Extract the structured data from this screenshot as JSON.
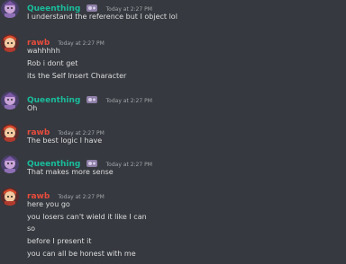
{
  "users": {
    "queenthing": {
      "name": "Queenthing",
      "color": "#1abc9c"
    },
    "rawb": {
      "name": "rawb",
      "color": "#e74c3c"
    }
  },
  "messages": [
    {
      "user": "Queenthing",
      "time": "Today at 2:27 PM",
      "lines": [
        "I understand the reference but I object lol"
      ]
    },
    {
      "user": "rawb",
      "time": "Today at 2:27 PM",
      "lines": [
        "wahhhhh",
        "Rob i dont get",
        "its the Self Insert Character"
      ]
    },
    {
      "user": "Queenthing",
      "time": "Today at 2:27 PM",
      "lines": [
        "Oh"
      ]
    },
    {
      "user": "rawb",
      "time": "Today at 2:27 PM",
      "lines": [
        "The best logic I have"
      ]
    },
    {
      "user": "Queenthing",
      "time": "Today at 2:27 PM",
      "lines": [
        "That makes more sense"
      ]
    },
    {
      "user": "rawb",
      "time": "Today at 2:27 PM",
      "lines": [
        "here you go",
        "you losers can't wield it like I can",
        "so",
        "before I present it",
        "you can all be honest with me"
      ]
    }
  ],
  "icons": {
    "queenthing_badge": "game-badge-icon",
    "queenthing_avatar": "character-avatar",
    "rawb_avatar": "character-avatar"
  }
}
